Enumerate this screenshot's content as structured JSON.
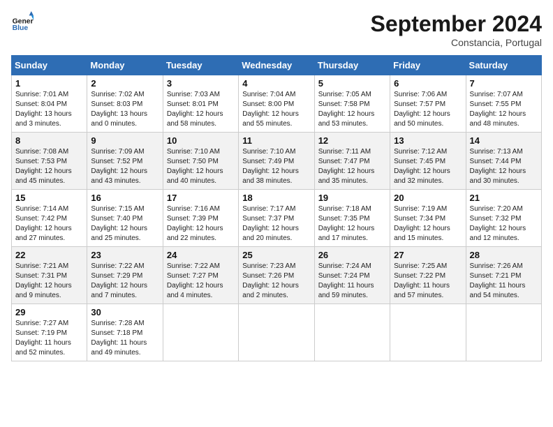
{
  "logo": {
    "line1": "General",
    "line2": "Blue"
  },
  "title": "September 2024",
  "location": "Constancia, Portugal",
  "days_of_week": [
    "Sunday",
    "Monday",
    "Tuesday",
    "Wednesday",
    "Thursday",
    "Friday",
    "Saturday"
  ],
  "weeks": [
    [
      {
        "day": "1",
        "sunrise": "7:01 AM",
        "sunset": "8:04 PM",
        "daylight": "13 hours and 3 minutes."
      },
      {
        "day": "2",
        "sunrise": "7:02 AM",
        "sunset": "8:03 PM",
        "daylight": "13 hours and 0 minutes."
      },
      {
        "day": "3",
        "sunrise": "7:03 AM",
        "sunset": "8:01 PM",
        "daylight": "12 hours and 58 minutes."
      },
      {
        "day": "4",
        "sunrise": "7:04 AM",
        "sunset": "8:00 PM",
        "daylight": "12 hours and 55 minutes."
      },
      {
        "day": "5",
        "sunrise": "7:05 AM",
        "sunset": "7:58 PM",
        "daylight": "12 hours and 53 minutes."
      },
      {
        "day": "6",
        "sunrise": "7:06 AM",
        "sunset": "7:57 PM",
        "daylight": "12 hours and 50 minutes."
      },
      {
        "day": "7",
        "sunrise": "7:07 AM",
        "sunset": "7:55 PM",
        "daylight": "12 hours and 48 minutes."
      }
    ],
    [
      {
        "day": "8",
        "sunrise": "7:08 AM",
        "sunset": "7:53 PM",
        "daylight": "12 hours and 45 minutes."
      },
      {
        "day": "9",
        "sunrise": "7:09 AM",
        "sunset": "7:52 PM",
        "daylight": "12 hours and 43 minutes."
      },
      {
        "day": "10",
        "sunrise": "7:10 AM",
        "sunset": "7:50 PM",
        "daylight": "12 hours and 40 minutes."
      },
      {
        "day": "11",
        "sunrise": "7:10 AM",
        "sunset": "7:49 PM",
        "daylight": "12 hours and 38 minutes."
      },
      {
        "day": "12",
        "sunrise": "7:11 AM",
        "sunset": "7:47 PM",
        "daylight": "12 hours and 35 minutes."
      },
      {
        "day": "13",
        "sunrise": "7:12 AM",
        "sunset": "7:45 PM",
        "daylight": "12 hours and 32 minutes."
      },
      {
        "day": "14",
        "sunrise": "7:13 AM",
        "sunset": "7:44 PM",
        "daylight": "12 hours and 30 minutes."
      }
    ],
    [
      {
        "day": "15",
        "sunrise": "7:14 AM",
        "sunset": "7:42 PM",
        "daylight": "12 hours and 27 minutes."
      },
      {
        "day": "16",
        "sunrise": "7:15 AM",
        "sunset": "7:40 PM",
        "daylight": "12 hours and 25 minutes."
      },
      {
        "day": "17",
        "sunrise": "7:16 AM",
        "sunset": "7:39 PM",
        "daylight": "12 hours and 22 minutes."
      },
      {
        "day": "18",
        "sunrise": "7:17 AM",
        "sunset": "7:37 PM",
        "daylight": "12 hours and 20 minutes."
      },
      {
        "day": "19",
        "sunrise": "7:18 AM",
        "sunset": "7:35 PM",
        "daylight": "12 hours and 17 minutes."
      },
      {
        "day": "20",
        "sunrise": "7:19 AM",
        "sunset": "7:34 PM",
        "daylight": "12 hours and 15 minutes."
      },
      {
        "day": "21",
        "sunrise": "7:20 AM",
        "sunset": "7:32 PM",
        "daylight": "12 hours and 12 minutes."
      }
    ],
    [
      {
        "day": "22",
        "sunrise": "7:21 AM",
        "sunset": "7:31 PM",
        "daylight": "12 hours and 9 minutes."
      },
      {
        "day": "23",
        "sunrise": "7:22 AM",
        "sunset": "7:29 PM",
        "daylight": "12 hours and 7 minutes."
      },
      {
        "day": "24",
        "sunrise": "7:22 AM",
        "sunset": "7:27 PM",
        "daylight": "12 hours and 4 minutes."
      },
      {
        "day": "25",
        "sunrise": "7:23 AM",
        "sunset": "7:26 PM",
        "daylight": "12 hours and 2 minutes."
      },
      {
        "day": "26",
        "sunrise": "7:24 AM",
        "sunset": "7:24 PM",
        "daylight": "11 hours and 59 minutes."
      },
      {
        "day": "27",
        "sunrise": "7:25 AM",
        "sunset": "7:22 PM",
        "daylight": "11 hours and 57 minutes."
      },
      {
        "day": "28",
        "sunrise": "7:26 AM",
        "sunset": "7:21 PM",
        "daylight": "11 hours and 54 minutes."
      }
    ],
    [
      {
        "day": "29",
        "sunrise": "7:27 AM",
        "sunset": "7:19 PM",
        "daylight": "11 hours and 52 minutes."
      },
      {
        "day": "30",
        "sunrise": "7:28 AM",
        "sunset": "7:18 PM",
        "daylight": "11 hours and 49 minutes."
      },
      null,
      null,
      null,
      null,
      null
    ]
  ],
  "labels": {
    "sunrise": "Sunrise:",
    "sunset": "Sunset:",
    "daylight": "Daylight:"
  }
}
